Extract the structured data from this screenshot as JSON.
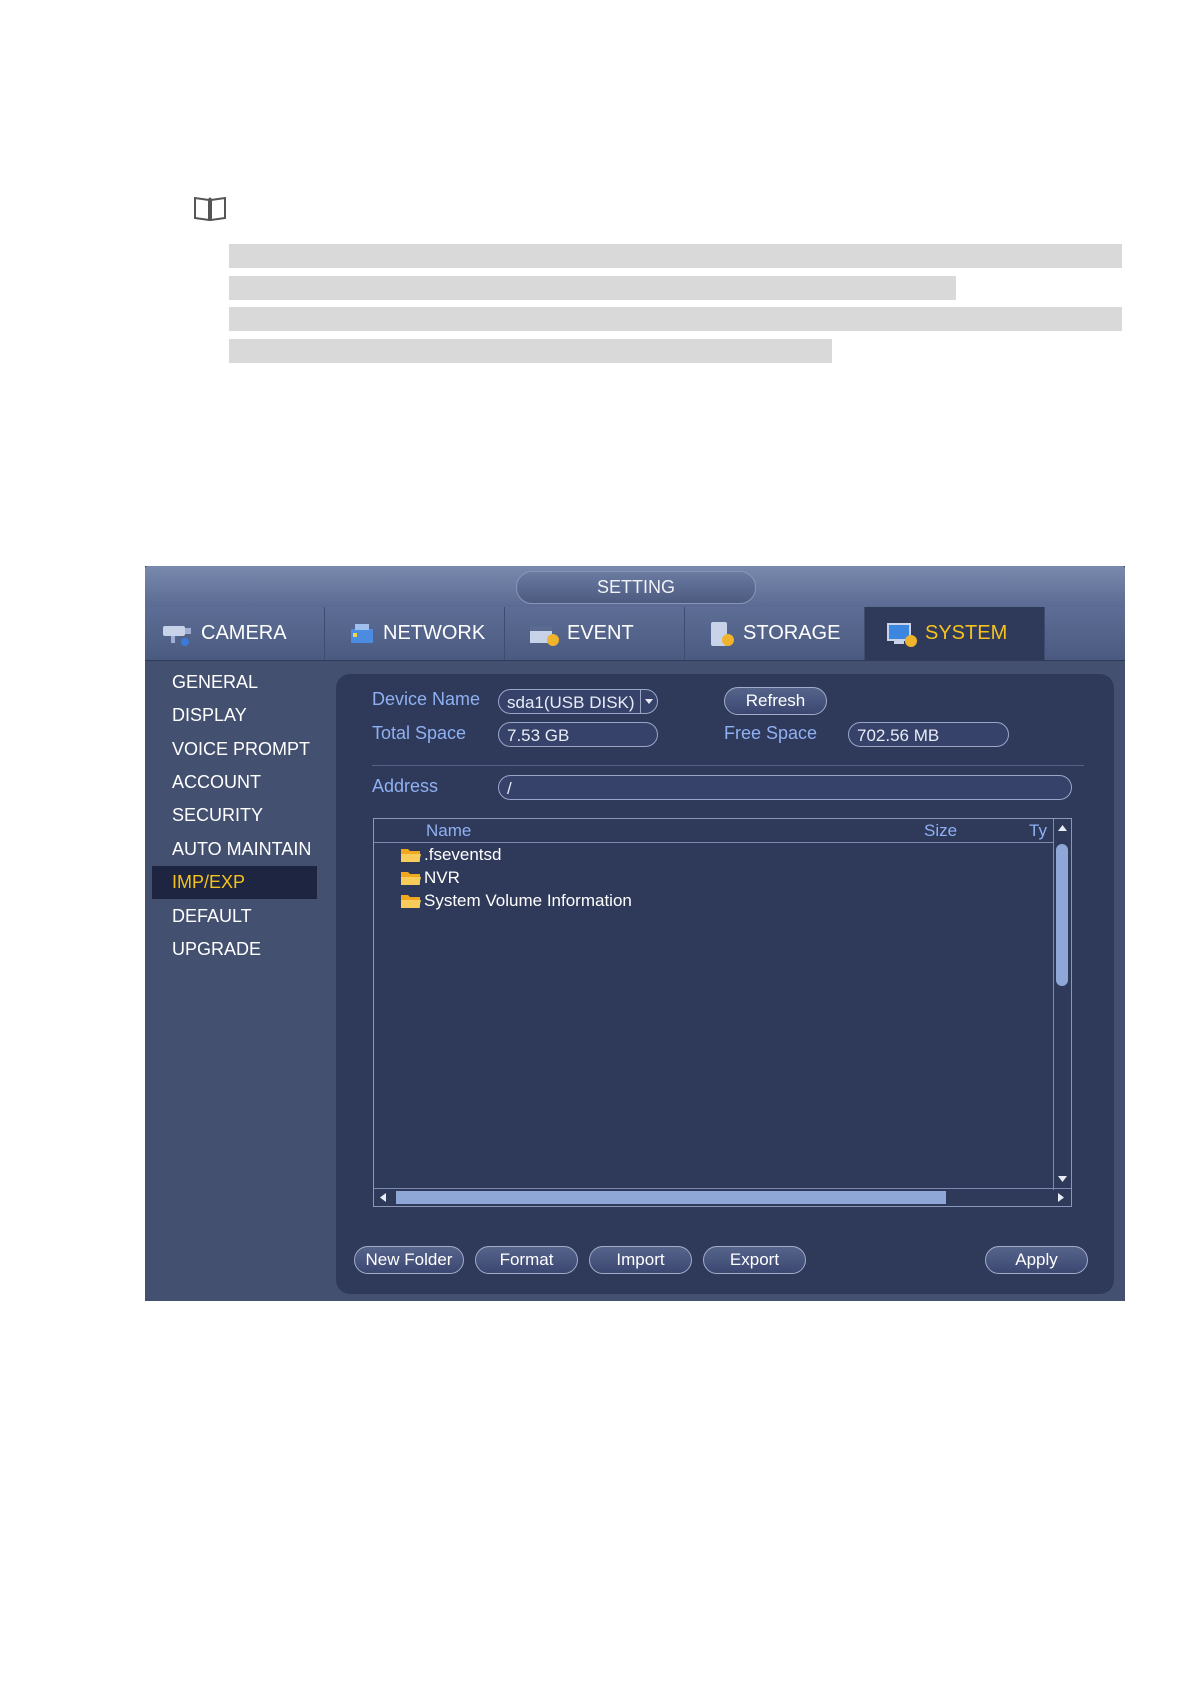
{
  "window": {
    "title": "SETTING"
  },
  "tabs": [
    {
      "label": "CAMERA",
      "icon": "camera-icon"
    },
    {
      "label": "NETWORK",
      "icon": "network-icon"
    },
    {
      "label": "EVENT",
      "icon": "event-icon"
    },
    {
      "label": "STORAGE",
      "icon": "storage-icon"
    },
    {
      "label": "SYSTEM",
      "icon": "system-icon",
      "active": true
    }
  ],
  "sidebar": {
    "items": [
      "GENERAL",
      "DISPLAY",
      "VOICE PROMPT",
      "ACCOUNT",
      "SECURITY",
      "AUTO MAINTAIN",
      "IMP/EXP",
      "DEFAULT",
      "UPGRADE"
    ],
    "active": "IMP/EXP"
  },
  "device": {
    "name_label": "Device Name",
    "name_value": "sda1(USB DISK)",
    "refresh_label": "Refresh",
    "total_label": "Total Space",
    "total_value": "7.53 GB",
    "free_label": "Free Space",
    "free_value": "702.56 MB"
  },
  "address": {
    "label": "Address",
    "value": "/"
  },
  "filelist": {
    "columns": [
      "Name",
      "Size",
      "Ty"
    ],
    "rows": [
      ".fseventsd",
      "NVR",
      "System Volume Information"
    ]
  },
  "buttons": {
    "new_folder": "New Folder",
    "format": "Format",
    "import": "Import",
    "export": "Export",
    "apply": "Apply"
  },
  "colors": {
    "window_bg": "#445070",
    "panel_bg": "#2f3a5a",
    "active_text": "#f6c21c",
    "label_text": "#8fb0f2"
  }
}
